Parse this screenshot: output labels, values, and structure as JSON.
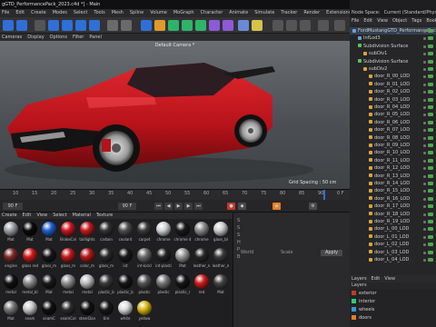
{
  "window": {
    "title": "gGTD_PerformancePack_2023.c4d *] - Main"
  },
  "menu": [
    "File",
    "Edit",
    "Create",
    "Modes",
    "Select",
    "Tools",
    "Mesh",
    "Spline",
    "Volume",
    "MoGraph",
    "Character",
    "Animate",
    "Simulate",
    "Tracker",
    "Render",
    "Extensions",
    "Window",
    "Help"
  ],
  "viewport": {
    "menu": [
      "Cameras",
      "Display",
      "Options",
      "Filter",
      "Panel"
    ],
    "camera_label": "Default Camera *",
    "grid_spacing": "Grid Spacing : 50 cm"
  },
  "timeline": {
    "ticks": [
      "10",
      "15",
      "20",
      "25",
      "30",
      "35",
      "40",
      "45",
      "50",
      "55",
      "60",
      "65",
      "70",
      "75",
      "80",
      "85",
      "90",
      "0 F"
    ]
  },
  "transport": {
    "current_frame": "90 F",
    "end_frame": "90 F"
  },
  "materials": {
    "menu": [
      "Create",
      "Edit",
      "View",
      "Select",
      "Material",
      "Texture"
    ],
    "items": [
      {
        "label": "Mat",
        "color": "#9aa0a6"
      },
      {
        "label": "Mat",
        "color": "#0a0a0a"
      },
      {
        "label": "Mat",
        "color": "#1f5fd0"
      },
      {
        "label": "BrakeCal",
        "color": "#c9171e"
      },
      {
        "label": "taillights",
        "color": "#c21a1a"
      },
      {
        "label": "carbon",
        "color": "#333333"
      },
      {
        "label": "coolant",
        "color": "#4e4e4e"
      },
      {
        "label": "carpet",
        "color": "#3a3a3a"
      },
      {
        "label": "chrome",
        "color": "#cfd3d6"
      },
      {
        "label": "chrome d",
        "color": "#1a1a1a"
      },
      {
        "label": "chrome",
        "color": "#8a8a8a"
      },
      {
        "label": "glass_bl",
        "color": "#cccccc"
      },
      {
        "label": "engine",
        "color": "#7a2a2a"
      },
      {
        "label": "glass red",
        "color": "#d01b1b"
      },
      {
        "label": "glass_m",
        "color": "#161616"
      },
      {
        "label": "glass_m",
        "color": "#bf1a1a"
      },
      {
        "label": "color_m",
        "color": "#b5191b"
      },
      {
        "label": "glass_m",
        "color": "#2a2a2a"
      },
      {
        "label": "int",
        "color": "#1a1a1a"
      },
      {
        "label": "int-kickl",
        "color": "#6b6b6b"
      },
      {
        "label": "int-plasti",
        "color": "#242424"
      },
      {
        "label": "Mat",
        "color": "#9a9a9a"
      },
      {
        "label": "leather_n",
        "color": "#292929"
      },
      {
        "label": "leather_n",
        "color": "#3a3a3a"
      },
      {
        "label": "metal",
        "color": "#111111"
      },
      {
        "label": "metal_bl",
        "color": "#8c8c8c"
      },
      {
        "label": "Mat",
        "color": "#1a1a1a"
      },
      {
        "label": "metal",
        "color": "#8f8f8f"
      },
      {
        "label": "metal",
        "color": "#bdbdbd"
      },
      {
        "label": "plastic_b",
        "color": "#3a3a3a"
      },
      {
        "label": "plastic_b",
        "color": "#151515"
      },
      {
        "label": "plastic",
        "color": "#555555"
      },
      {
        "label": "plastic",
        "color": "#777777"
      },
      {
        "label": "plastic_r",
        "color": "#151515"
      },
      {
        "label": "red",
        "color": "#d01b1b"
      },
      {
        "label": "Mat",
        "color": "#444444"
      },
      {
        "label": "Mat",
        "color": "#777777"
      },
      {
        "label": "seam",
        "color": "#c9c9c9"
      },
      {
        "label": "seamC",
        "color": "#101010"
      },
      {
        "label": "seamCol",
        "color": "#2d2d2d"
      },
      {
        "label": "steerDan",
        "color": "#111111"
      },
      {
        "label": "tire",
        "color": "#181818"
      },
      {
        "label": "white",
        "color": "#dcdcdc"
      },
      {
        "label": "yellow",
        "color": "#d8b715"
      }
    ]
  },
  "attributes": {
    "rows": [
      "S",
      "S",
      "S",
      "H",
      "P",
      "B"
    ],
    "apply_label": "Apply",
    "world_label": "World",
    "scale_label": "Scale"
  },
  "right_tabs": [
    "Node Space:",
    "Current (Standard/Physical)"
  ],
  "objects_menu": [
    "File",
    "Edit",
    "View",
    "Object",
    "Tags",
    "Bookmarks"
  ],
  "object_tree": [
    {
      "label": "FordMustangGTD_PerformancePack_2023",
      "indent": 0,
      "color": "#6aa0e0"
    },
    {
      "label": "InfLod3",
      "indent": 1,
      "color": "#6aa0e0"
    },
    {
      "label": "Subdivision Surface",
      "indent": 1,
      "color": "#5fc05f"
    },
    {
      "label": "subDiv1",
      "indent": 2,
      "color": "#d9a441"
    },
    {
      "label": "Subdivision Surface",
      "indent": 1,
      "color": "#5fc05f"
    },
    {
      "label": "subDiv2",
      "indent": 2,
      "color": "#d9a441"
    },
    {
      "label": "door_R_00_LOD",
      "indent": 3,
      "color": "#d9a441"
    },
    {
      "label": "door_R_01_LOD",
      "indent": 3,
      "color": "#d9a441"
    },
    {
      "label": "door_R_02_LOD",
      "indent": 3,
      "color": "#d9a441"
    },
    {
      "label": "door_R_03_LOD",
      "indent": 3,
      "color": "#d9a441"
    },
    {
      "label": "door_R_04_LOD",
      "indent": 3,
      "color": "#d9a441"
    },
    {
      "label": "door_R_05_LOD",
      "indent": 3,
      "color": "#d9a441"
    },
    {
      "label": "door_R_06_LOD",
      "indent": 3,
      "color": "#d9a441"
    },
    {
      "label": "door_R_07_LOD",
      "indent": 3,
      "color": "#d9a441"
    },
    {
      "label": "door_R_08_LOD",
      "indent": 3,
      "color": "#d9a441"
    },
    {
      "label": "door_R_09_LOD",
      "indent": 3,
      "color": "#d9a441"
    },
    {
      "label": "door_R_10_LOD",
      "indent": 3,
      "color": "#d9a441"
    },
    {
      "label": "door_R_11_LOD",
      "indent": 3,
      "color": "#d9a441"
    },
    {
      "label": "door_R_12_LOD",
      "indent": 3,
      "color": "#d9a441"
    },
    {
      "label": "door_R_13_LOD",
      "indent": 3,
      "color": "#d9a441"
    },
    {
      "label": "door_R_14_LOD",
      "indent": 3,
      "color": "#d9a441"
    },
    {
      "label": "door_R_15_LOD",
      "indent": 3,
      "color": "#d9a441"
    },
    {
      "label": "door_R_16_LOD",
      "indent": 3,
      "color": "#d9a441"
    },
    {
      "label": "door_R_17_LOD",
      "indent": 3,
      "color": "#d9a441"
    },
    {
      "label": "door_R_18_LOD",
      "indent": 3,
      "color": "#d9a441"
    },
    {
      "label": "door_R_19_LOD",
      "indent": 3,
      "color": "#d9a441"
    },
    {
      "label": "door_L_00_LOD",
      "indent": 3,
      "color": "#d9a441"
    },
    {
      "label": "door_L_01_LOD",
      "indent": 3,
      "color": "#d9a441"
    },
    {
      "label": "door_L_02_LOD",
      "indent": 3,
      "color": "#d9a441"
    },
    {
      "label": "door_L_03_LOD",
      "indent": 3,
      "color": "#d9a441"
    },
    {
      "label": "door_L_04_LOD",
      "indent": 3,
      "color": "#d9a441"
    }
  ],
  "layers_menu": [
    "Layers",
    "Edit",
    "View"
  ],
  "layers_sub": [
    "Layers"
  ],
  "layers": [
    {
      "label": "exterior",
      "color": "#c0392b"
    },
    {
      "label": "interior",
      "color": "#2ecc71"
    },
    {
      "label": "wheels",
      "color": "#3498db"
    },
    {
      "label": "doors",
      "color": "#e67e22"
    }
  ],
  "colors": {
    "car_red": "#c3141b",
    "viewport_bg": "#4b4f53",
    "accent_blue": "#2f6fd6"
  }
}
